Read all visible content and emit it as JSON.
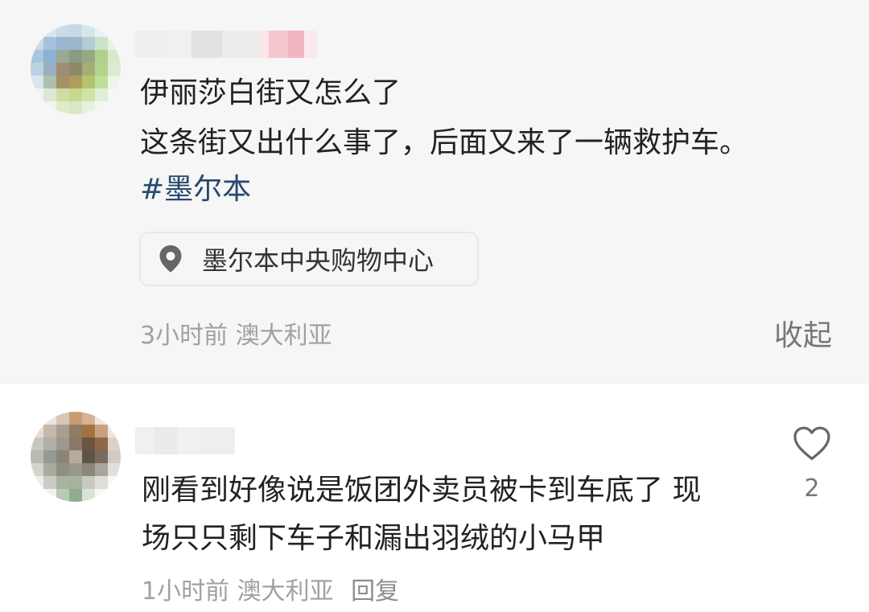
{
  "post": {
    "title": "伊丽莎白街又怎么了",
    "body": "这条街又出什么事了，后面又来了一辆救护车。",
    "hashtag": "#墨尔本",
    "location": {
      "icon": "location-pin-icon",
      "label": "墨尔本中央购物中心"
    },
    "meta": "3小时前 澳大利亚",
    "collapse_label": "收起"
  },
  "comment": {
    "line_1": "刚看到好像说是饭团外卖员被卡到车底了 现",
    "line_2": "场只只剩下车子和漏出羽绒的小马甲",
    "meta": "1小时前 澳大利亚",
    "reply_label": "回复",
    "like_icon": "heart-icon",
    "like_count": "2"
  },
  "colors": {
    "post_background": "#f6f6f6",
    "text": "#222222",
    "hashtag": "#27496f",
    "muted_text": "#a1a1a1",
    "location_border": "#e7e7e7"
  }
}
